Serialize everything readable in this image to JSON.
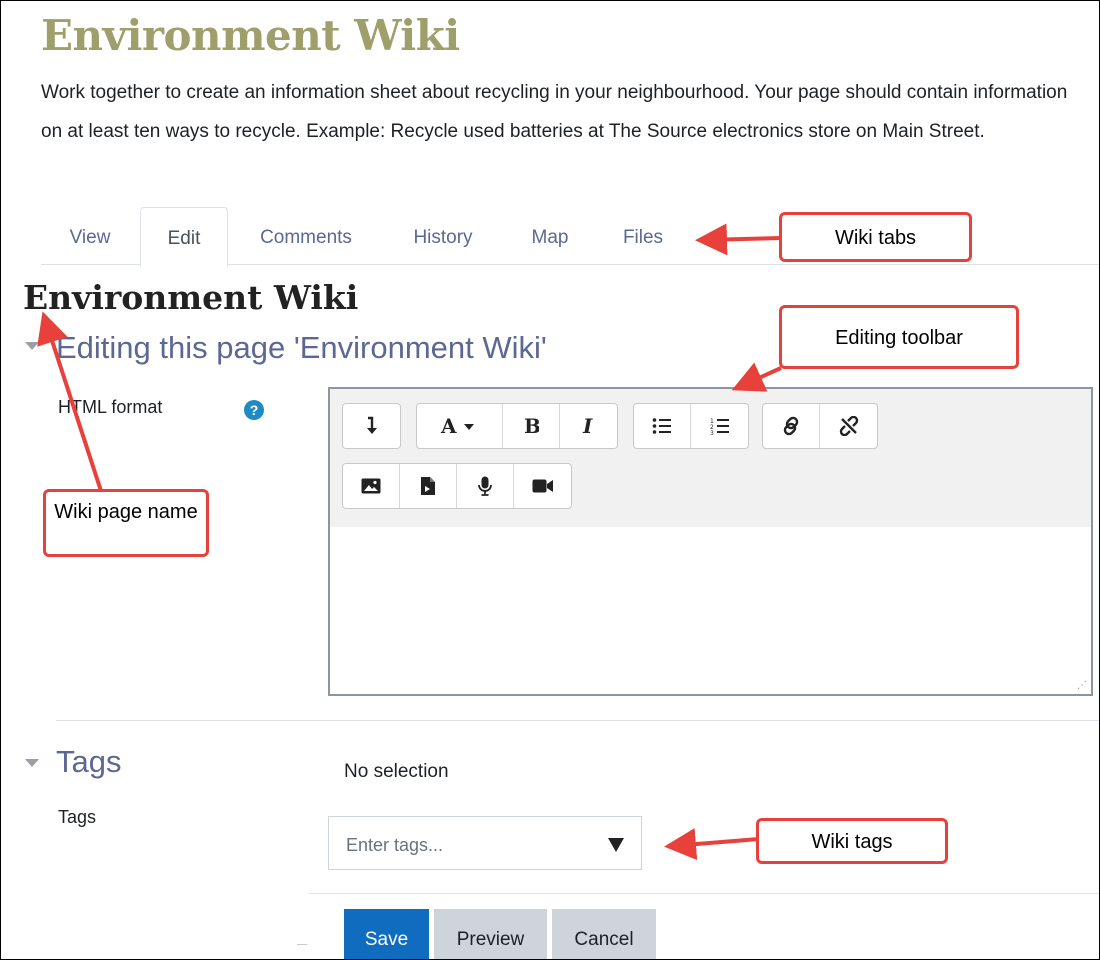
{
  "wiki": {
    "title": "Environment Wiki",
    "description": "Work together to create an information sheet about recycling in your neighbourhood. Your page should contain information on at least ten ways to recycle. Example: Recycle used batteries at The Source electronics store on Main Street."
  },
  "tabs": [
    {
      "label": "View",
      "active": false
    },
    {
      "label": "Edit",
      "active": true
    },
    {
      "label": "Comments",
      "active": false
    },
    {
      "label": "History",
      "active": false
    },
    {
      "label": "Map",
      "active": false
    },
    {
      "label": "Files",
      "active": false
    }
  ],
  "page": {
    "name": "Environment Wiki",
    "editing_heading": "Editing this page 'Environment Wiki'",
    "format_label": "HTML format",
    "help_icon": "question-circle-icon"
  },
  "editor_toolbar": {
    "row1": [
      [
        "show-more-icon"
      ],
      [
        "font-style-icon",
        "bold-icon",
        "italic-icon"
      ],
      [
        "unordered-list-icon",
        "ordered-list-icon"
      ],
      [
        "link-icon",
        "unlink-icon"
      ]
    ],
    "row2": [
      [
        "image-icon",
        "media-file-icon",
        "microphone-icon",
        "video-camera-icon"
      ]
    ]
  },
  "tags": {
    "heading": "Tags",
    "field_label": "Tags",
    "selection_text": "No selection",
    "placeholder": "Enter tags..."
  },
  "buttons": {
    "save": "Save",
    "preview": "Preview",
    "cancel": "Cancel"
  },
  "annotations": {
    "wiki_tabs": "Wiki tabs",
    "editing_toolbar": "Editing toolbar",
    "wiki_page_name": "Wiki page name",
    "wiki_tags": "Wiki tags",
    "color": "#e8403b"
  },
  "colors": {
    "title": "#9f9f6c",
    "link": "#5d6794",
    "primary": "#0f6cbf",
    "secondary": "#ced4da",
    "help": "#1f8bc2"
  }
}
